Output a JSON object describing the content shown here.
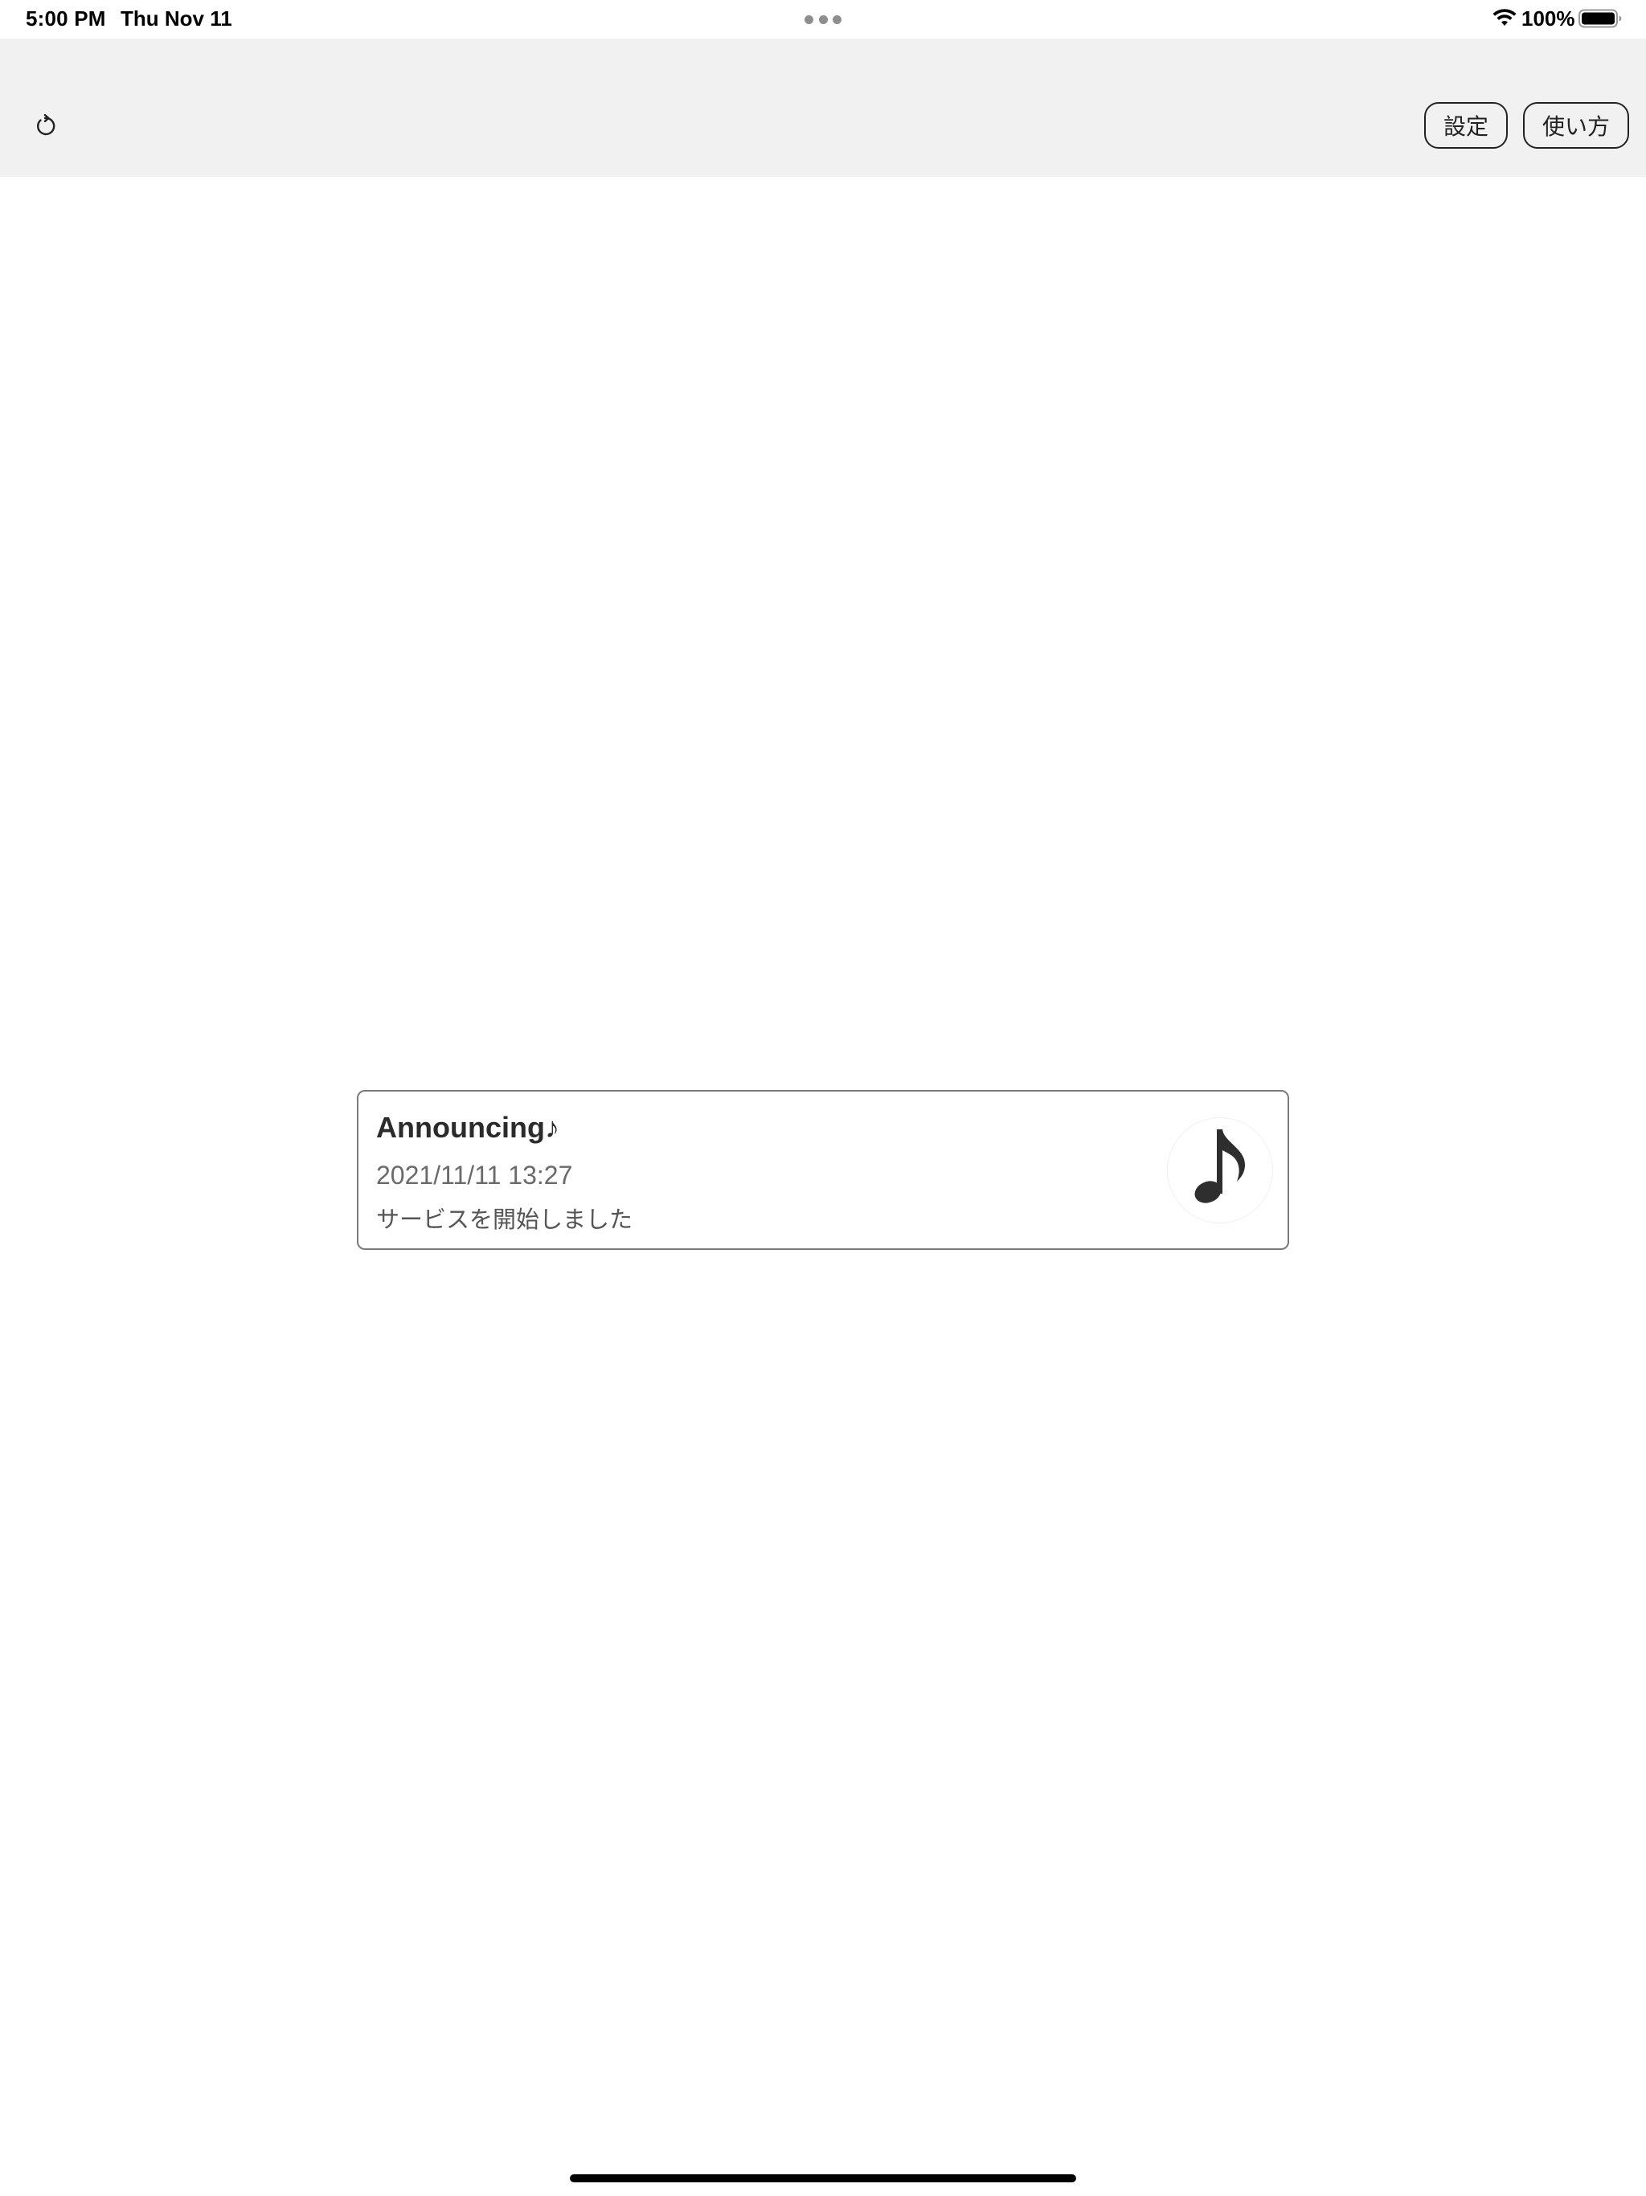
{
  "status_bar": {
    "time": "5:00 PM",
    "date": "Thu Nov 11",
    "battery_percent": "100%",
    "wifi_icon": "wifi-icon",
    "battery_icon": "battery-full-icon"
  },
  "toolbar": {
    "refresh_icon": "refresh-icon",
    "settings_label": "設定",
    "howto_label": "使い方"
  },
  "notification": {
    "title": "Announcing♪",
    "date": "2021/11/11 13:27",
    "message": "サービスを開始しました",
    "icon": "music-note-icon"
  },
  "colors": {
    "toolbar_bg": "#f1f1f1",
    "card_border": "#7a7a7a",
    "text_dark": "#2b2b2b",
    "text_muted": "#6a6a6a"
  }
}
